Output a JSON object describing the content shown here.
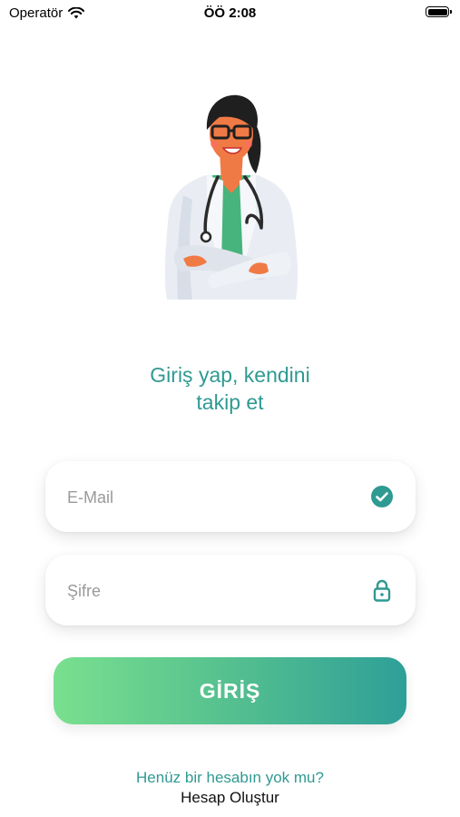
{
  "status_bar": {
    "carrier": "Operatör",
    "time": "ÖÖ 2:08"
  },
  "illustration": {
    "icon": "doctor-illustration"
  },
  "headline": {
    "line1": "Giriş yap, kendini",
    "line2": "takip et"
  },
  "email_field": {
    "placeholder": "E-Mail",
    "value": "",
    "icon": "check-circle-icon"
  },
  "password_field": {
    "placeholder": "Şifre",
    "value": "",
    "icon": "lock-icon"
  },
  "login_button": {
    "label": "GİRİŞ"
  },
  "signup": {
    "question": "Henüz bir hesabın yok mu?",
    "link": "Hesap Oluştur"
  },
  "colors": {
    "accent": "#2f9a92",
    "button_start": "#79e08f",
    "button_end": "#2e9f98"
  }
}
